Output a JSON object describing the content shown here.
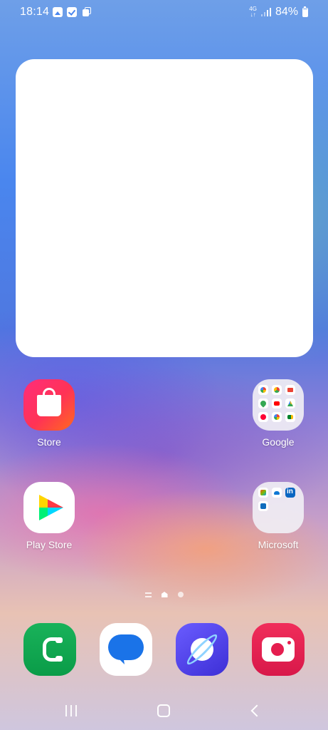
{
  "status_bar": {
    "time": "18:14",
    "notification_icons": [
      "gallery-icon",
      "check-icon",
      "copy-icon"
    ],
    "network_type_top": "4G",
    "network_type_bottom": "↓↑",
    "battery_percent": "84%",
    "battery_level": 0.84,
    "charging": true
  },
  "widget": {
    "background": "#ffffff"
  },
  "home_apps": [
    {
      "label": "Store",
      "icon": "galaxy-store-icon"
    },
    {
      "label": "Google",
      "icon": "folder-icon"
    },
    {
      "label": "Play Store",
      "icon": "play-store-icon"
    },
    {
      "label": "Microsoft",
      "icon": "folder-icon"
    }
  ],
  "folders": {
    "google": [
      "google-icon",
      "chrome-icon",
      "gmail-icon",
      "maps-icon",
      "youtube-icon",
      "drive-icon",
      "youtube-music-icon",
      "photos-icon",
      "meet-icon"
    ],
    "microsoft": [
      "office-icon",
      "onedrive-icon",
      "linkedin-icon",
      "outlook-icon"
    ]
  },
  "page_indicator": {
    "pages": 2,
    "current_page": 1
  },
  "dock": [
    {
      "icon": "phone-icon",
      "color": "#13a852"
    },
    {
      "icon": "messages-icon",
      "color": "#1a73e8"
    },
    {
      "icon": "internet-icon",
      "color": "#5548f0"
    },
    {
      "icon": "camera-icon",
      "color": "#e51e4f"
    }
  ],
  "navigation": [
    "recents-button",
    "home-button",
    "back-button"
  ]
}
